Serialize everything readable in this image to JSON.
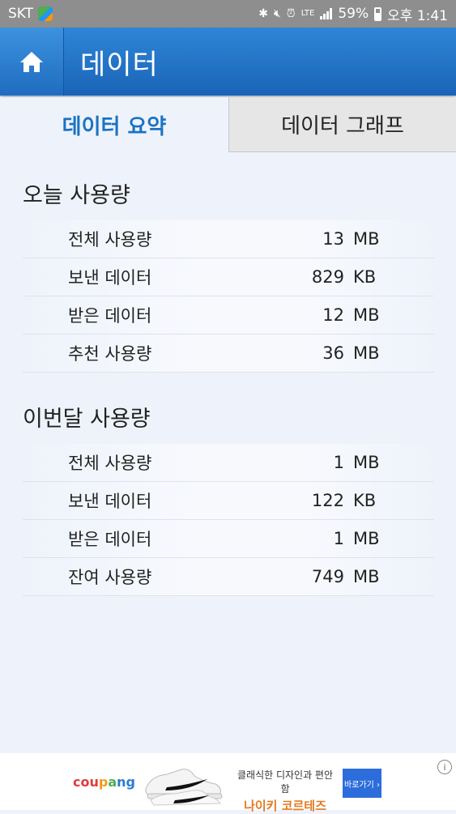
{
  "statusbar": {
    "carrier": "SKT",
    "lte": "LTE",
    "battery": "59%",
    "time": "오후 1:41"
  },
  "header": {
    "title": "데이터"
  },
  "tabs": [
    {
      "label": "데이터 요약",
      "active": true
    },
    {
      "label": "데이터 그래프",
      "active": false
    }
  ],
  "today": {
    "title": "오늘 사용량",
    "rows": [
      {
        "label": "전체 사용량",
        "value": "13",
        "unit": "MB"
      },
      {
        "label": "보낸 데이터",
        "value": "829",
        "unit": "KB"
      },
      {
        "label": "받은 데이터",
        "value": "12",
        "unit": "MB"
      },
      {
        "label": "추천 사용량",
        "value": "36",
        "unit": "MB"
      }
    ]
  },
  "month": {
    "title": "이번달 사용량",
    "rows": [
      {
        "label": "전체 사용량",
        "value": "1",
        "unit": "MB"
      },
      {
        "label": "보낸 데이터",
        "value": "122",
        "unit": "KB"
      },
      {
        "label": "받은 데이터",
        "value": "1",
        "unit": "MB"
      },
      {
        "label": "잔여 사용량",
        "value": "749",
        "unit": "MB"
      }
    ]
  },
  "ad": {
    "logo": [
      "cou",
      "p",
      "a",
      "ng"
    ],
    "line1": "클래식한 디자인과 편안함",
    "line2": "나이키 코르테즈",
    "button": "바로가기 ›",
    "info": "i"
  }
}
